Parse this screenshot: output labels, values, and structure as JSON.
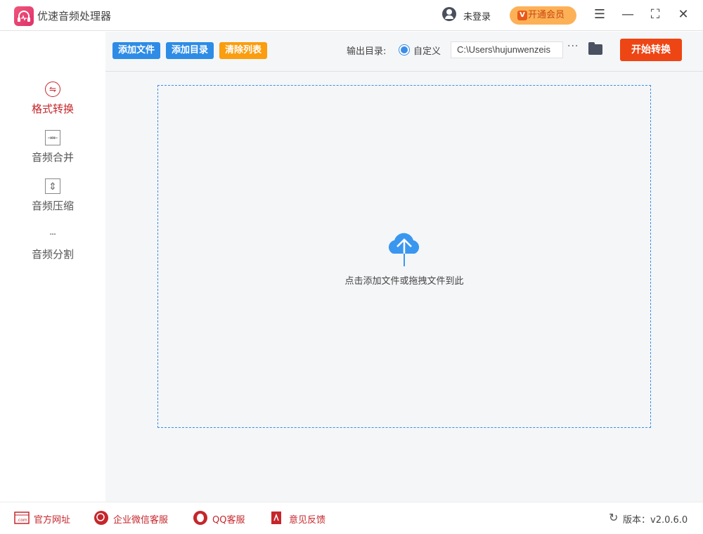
{
  "app": {
    "title": "优速音频处理器",
    "login": "未登录",
    "vip": "开通会员",
    "vip_icon_letter": "V"
  },
  "sidebar": {
    "items": [
      {
        "label": "格式转换",
        "icon": "⇋"
      },
      {
        "label": "音频合并",
        "icon": "⇥⇤"
      },
      {
        "label": "音频压缩",
        "icon": "⇕"
      },
      {
        "label": "音频分割",
        "icon": "┄"
      }
    ]
  },
  "toolbar": {
    "add_file": "添加文件",
    "add_dir": "添加目录",
    "clear": "清除列表",
    "output_label": "输出目录:",
    "radio_label": "自定义",
    "path": "C:\\Users\\hujunwenzeis",
    "more": "···",
    "start": "开始转换"
  },
  "main": {
    "drop_hint": "点击添加文件或拖拽文件到此"
  },
  "footer": {
    "website": "官方网址",
    "wechat": "企业微信客服",
    "qq": "QQ客服",
    "feedback": "意见反馈",
    "version": "版本：v2.0.6.0"
  },
  "colors": {
    "blue": "#2e8ce6",
    "orange": "#fa9d0f",
    "red": "#ee4514",
    "accent": "#c5262b"
  }
}
